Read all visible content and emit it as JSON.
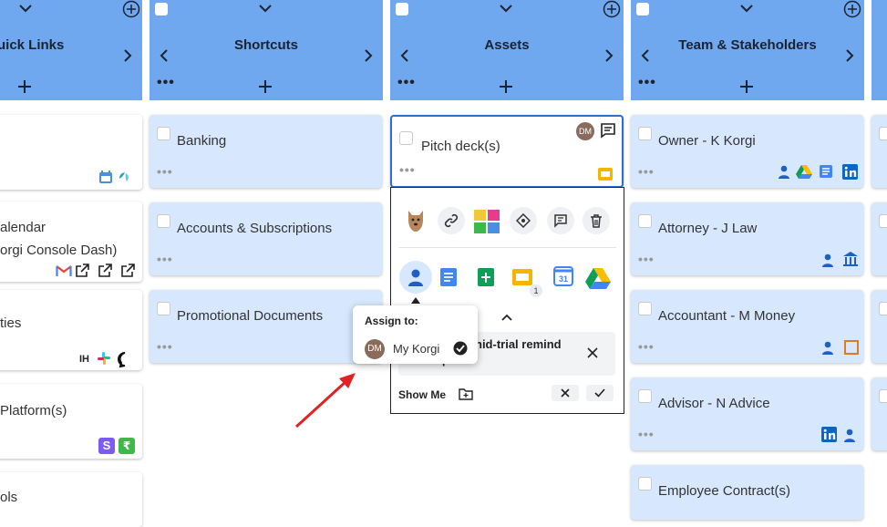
{
  "columns": [
    {
      "title": "uick Links"
    },
    {
      "title": "Shortcuts"
    },
    {
      "title": "Assets"
    },
    {
      "title": "Team & Stakeholders"
    }
  ],
  "quick_links": {
    "cards": [
      {
        "lines": []
      },
      {
        "lines": [
          "alendar",
          "orgi Console Dash)"
        ]
      },
      {
        "lines": [
          "ties"
        ]
      },
      {
        "lines": [
          "Platform(s)"
        ]
      },
      {
        "lines": [
          "ols"
        ]
      }
    ],
    "badge_text": "IH"
  },
  "shortcuts": {
    "cards": [
      "Banking",
      "Accounts & Subscriptions",
      "Promotional Documents"
    ]
  },
  "assets": {
    "card": "Pitch deck(s)",
    "avatar": "DM"
  },
  "team": {
    "cards": [
      "Owner - K Korgi",
      "Attorney - J Law",
      "Accountant - M Money",
      "Advisor - N Advice",
      "Employee Contract(s)"
    ]
  },
  "popup": {
    "badge_count": "1",
    "reminder_text": "nid-trial remind",
    "reminder_sub": "q",
    "show_me": "Show Me"
  },
  "tooltip": {
    "title": "Assign to:",
    "user_initials": "DM",
    "user_name": "My Korgi"
  },
  "colors": {
    "header": "#6fa8ee",
    "card": "#d7e7fd",
    "accent": "#2b6fd6",
    "arrow": "#e02424"
  }
}
